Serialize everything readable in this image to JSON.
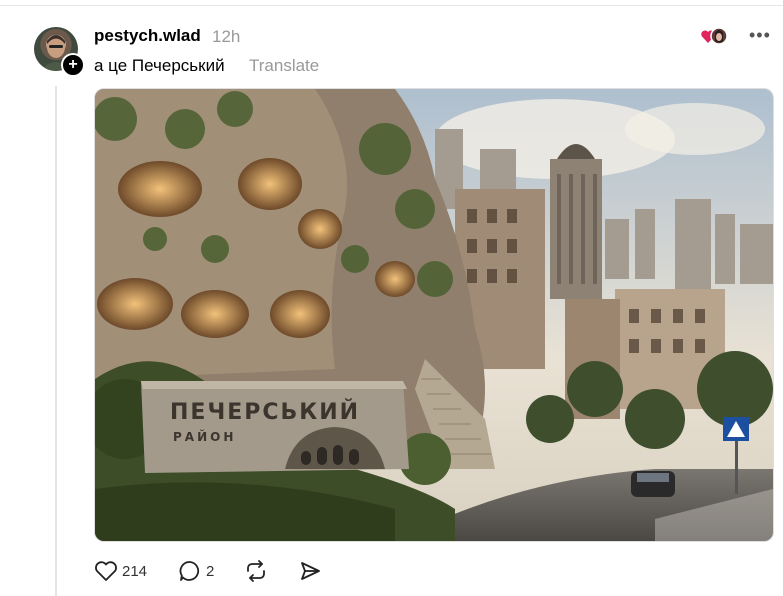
{
  "post": {
    "username": "pestych.wlad",
    "time": "12h",
    "text": "а це Печерський",
    "translate_label": "Translate",
    "more_icon": "more-horizontal-icon",
    "reactor_icon": "heart-avatar-icon"
  },
  "media": {
    "sign_line1": "ПЕЧЕРСЬКИЙ",
    "sign_line2": "РАЙОН"
  },
  "actions": {
    "likes": "214",
    "comments": "2",
    "like_icon": "heart-icon",
    "comment_icon": "comment-icon",
    "repost_icon": "repost-icon",
    "share_icon": "share-icon"
  },
  "colors": {
    "muted": "#999999",
    "like_accent": "#e0245e"
  }
}
